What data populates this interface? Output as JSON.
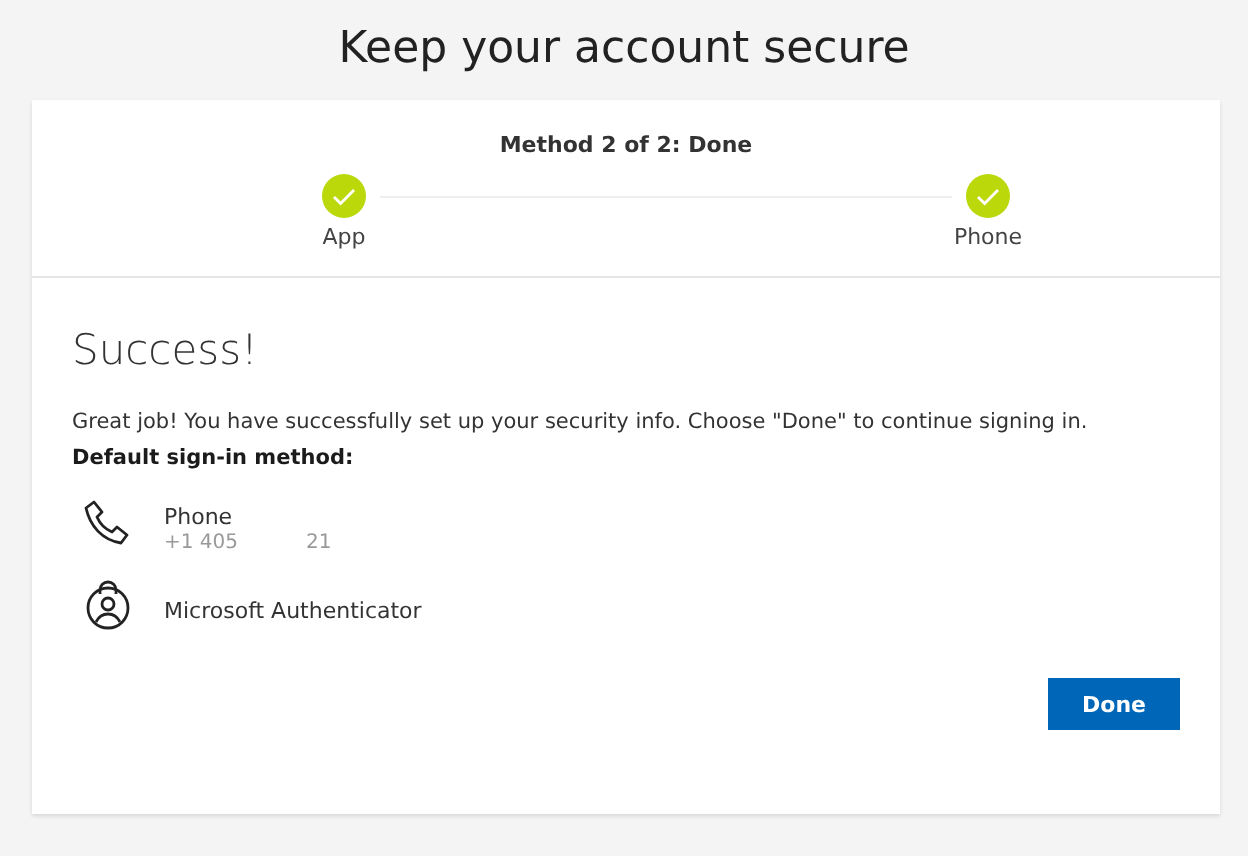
{
  "page_title": "Keep your account secure",
  "progress": {
    "caption": "Method 2 of 2: Done",
    "steps": [
      {
        "label": "App",
        "done": true
      },
      {
        "label": "Phone",
        "done": true
      }
    ]
  },
  "heading": "Success!",
  "message": "Great job! You have successfully set up your security info. Choose \"Done\" to continue signing in.",
  "default_label": "Default sign-in method:",
  "methods": [
    {
      "kind": "phone",
      "name": "Phone",
      "detail_start": "+1 405",
      "detail_end": "21"
    },
    {
      "kind": "authenticator",
      "name": "Microsoft Authenticator"
    }
  ],
  "buttons": [
    {
      "label": "Done"
    }
  ]
}
